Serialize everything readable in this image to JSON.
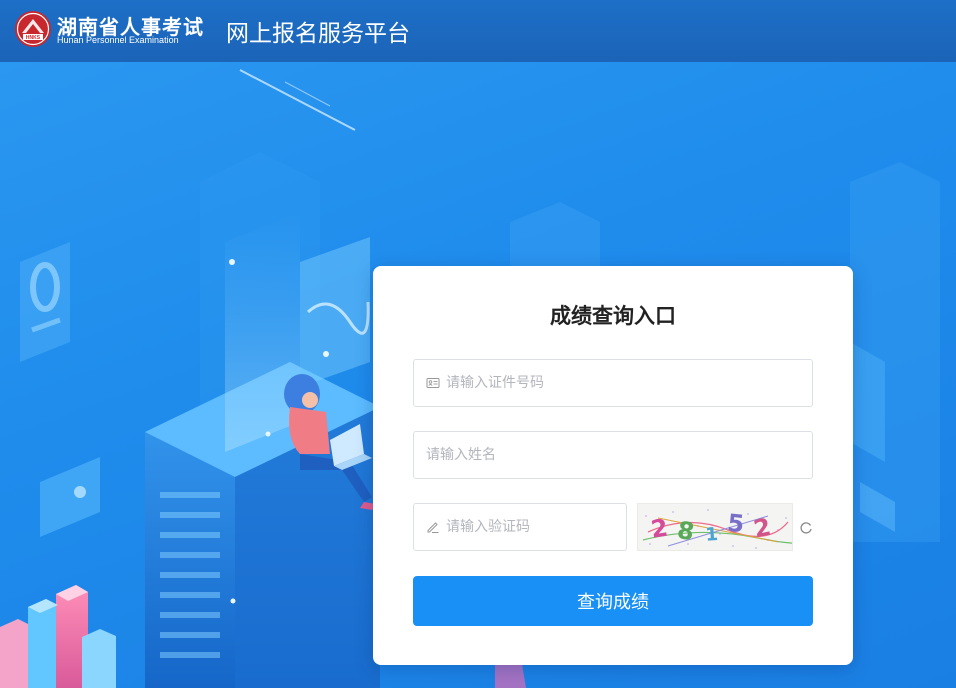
{
  "header": {
    "brand_cn": "湖南省人事考试",
    "brand_en": "Hunan Personnel Examination",
    "logo_text": "HNKS",
    "platform_title": "网上报名服务平台"
  },
  "form": {
    "title": "成绩查询入口",
    "id_placeholder": "请输入证件号码",
    "name_placeholder": "请输入姓名",
    "code_placeholder": "请输入验证码",
    "captcha_chars": [
      "2",
      "8",
      "1",
      "5",
      "2"
    ],
    "submit_label": "查询成绩"
  },
  "colors": {
    "header_bg": "#1b64b8",
    "page_bg": "#1f8cec",
    "button": "#1890f5",
    "logo_red": "#c8272d"
  },
  "icons": {
    "id_field": "id-card-icon",
    "code_field": "pencil-icon",
    "refresh": "refresh-icon"
  }
}
